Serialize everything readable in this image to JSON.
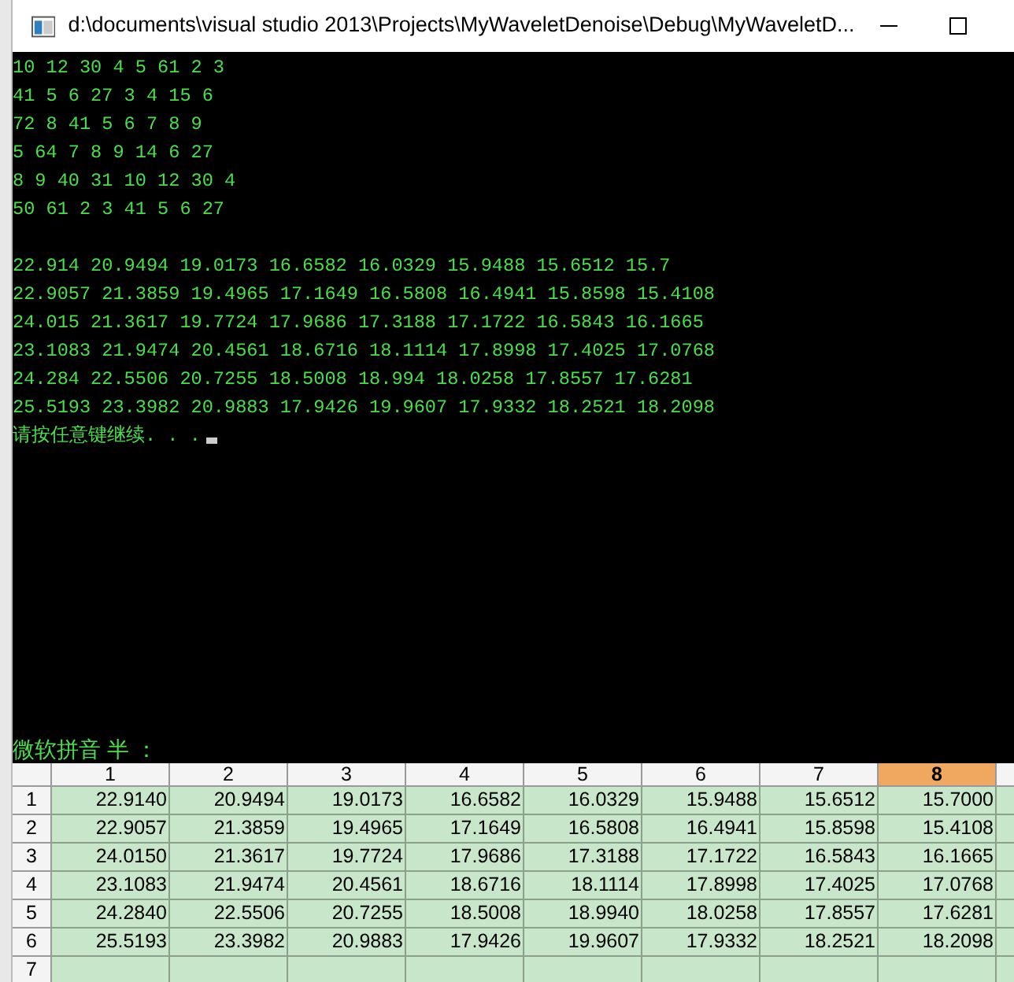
{
  "window": {
    "title": "d:\\documents\\visual studio 2013\\Projects\\MyWaveletDenoise\\Debug\\MyWaveletD..."
  },
  "console": {
    "matrix_lines": [
      "10 12 30 4 5 61 2 3",
      "41 5 6 27 3 4 15 6",
      "72 8 41 5 6 7 8 9",
      "5 64 7 8 9 14 6 27",
      "8 9 40 31 10 12 30 4",
      "50 61 2 3 41 5 6 27"
    ],
    "result_lines": [
      "22.914 20.9494 19.0173 16.6582 16.0329 15.9488 15.6512 15.7",
      "22.9057 21.3859 19.4965 17.1649 16.5808 16.4941 15.8598 15.4108",
      "24.015 21.3617 19.7724 17.9686 17.3188 17.1722 16.5843 16.1665",
      "23.1083 21.9474 20.4561 18.6716 18.1114 17.8998 17.4025 17.0768",
      "24.284 22.5506 20.7255 18.5008 18.994 18.0258 17.8557 17.6281",
      "25.5193 23.3982 20.9883 17.9426 19.9607 17.9332 18.2521 18.2098"
    ],
    "prompt": "请按任意键继续. . .",
    "ime_status": "微软拼音 半 ："
  },
  "spreadsheet": {
    "columns": [
      {
        "label": "1",
        "selected": false
      },
      {
        "label": "2",
        "selected": false
      },
      {
        "label": "3",
        "selected": false
      },
      {
        "label": "4",
        "selected": false
      },
      {
        "label": "5",
        "selected": false
      },
      {
        "label": "6",
        "selected": false
      },
      {
        "label": "7",
        "selected": false
      },
      {
        "label": "8",
        "selected": true
      }
    ],
    "rows": [
      {
        "label": "1",
        "cells": [
          "22.9140",
          "20.9494",
          "19.0173",
          "16.6582",
          "16.0329",
          "15.9488",
          "15.6512",
          "15.7000"
        ]
      },
      {
        "label": "2",
        "cells": [
          "22.9057",
          "21.3859",
          "19.4965",
          "17.1649",
          "16.5808",
          "16.4941",
          "15.8598",
          "15.4108"
        ]
      },
      {
        "label": "3",
        "cells": [
          "24.0150",
          "21.3617",
          "19.7724",
          "17.9686",
          "17.3188",
          "17.1722",
          "16.5843",
          "16.1665"
        ]
      },
      {
        "label": "4",
        "cells": [
          "23.1083",
          "21.9474",
          "20.4561",
          "18.6716",
          "18.1114",
          "17.8998",
          "17.4025",
          "17.0768"
        ]
      },
      {
        "label": "5",
        "cells": [
          "24.2840",
          "22.5506",
          "20.7255",
          "18.5008",
          "18.9940",
          "18.0258",
          "17.8557",
          "17.6281"
        ]
      },
      {
        "label": "6",
        "cells": [
          "25.5193",
          "23.3982",
          "20.9883",
          "17.9426",
          "19.9607",
          "17.9332",
          "18.2521",
          "18.2098"
        ]
      },
      {
        "label": "7"
      }
    ]
  }
}
